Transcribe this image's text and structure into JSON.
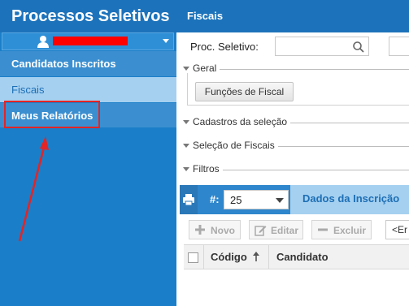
{
  "sidebar": {
    "app_title": "Processos Seletivos",
    "items": [
      {
        "label": "Candidatos Inscritos"
      },
      {
        "label": "Fiscais"
      },
      {
        "label": "Meus Relatórios"
      }
    ]
  },
  "main": {
    "header_title": "Fiscais",
    "filter": {
      "label": "Proc. Seletivo:",
      "value": ""
    },
    "sections": [
      {
        "title": "Geral"
      },
      {
        "title": "Cadastros da seleção"
      },
      {
        "title": "Seleção de Fiscais"
      },
      {
        "title": "Filtros"
      }
    ],
    "geral_button": "Funções de Fiscal"
  },
  "grid": {
    "hash_label": "#:",
    "page_size": "25",
    "tab_label": "Dados da Inscrição",
    "actions": {
      "new": "Novo",
      "edit": "Editar",
      "delete": "Excluir"
    },
    "filter_text": "<Er",
    "columns": [
      "Código",
      "Candidato"
    ]
  },
  "icons": {
    "user": "user-icon",
    "search": "search-icon",
    "print": "print-icon",
    "sort": "sort-asc-icon"
  },
  "colors": {
    "primary": "#1b7ec9",
    "header": "#1d73bb",
    "active_nav": "#a5d0f0",
    "highlight": "#e52424"
  }
}
